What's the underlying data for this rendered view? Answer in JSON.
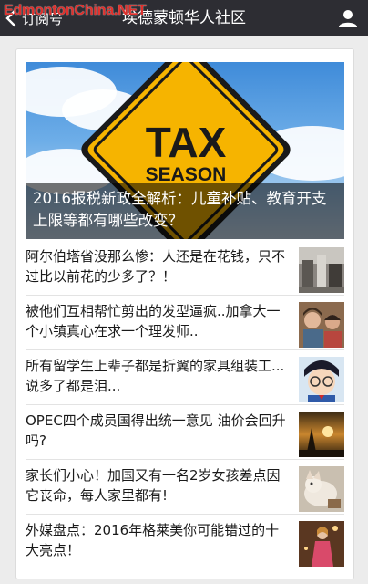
{
  "watermark": "EdmontonChina.NET",
  "nav": {
    "back_label": "订阅号",
    "title": "埃德蒙顿华人社区"
  },
  "hero": {
    "sign_line1": "TAX",
    "sign_line2": "SEASON",
    "caption": "2016报税新政全解析：儿童补贴、教育开支上限等都有哪些改变？"
  },
  "articles": [
    {
      "title": "阿尔伯塔省没那么惨：人还是在花钱，只不过比以前花的少多了？！",
      "thumb_icon": "city-street-photo-icon"
    },
    {
      "title": "被他们互相帮忙剪出的发型逼疯..加拿大一个小镇真心在求一个理发师..",
      "thumb_icon": "people-photo-icon"
    },
    {
      "title": "所有留学生上辈子都是折翼的家具组装工...说多了都是泪...",
      "thumb_icon": "cartoon-boy-photo-icon"
    },
    {
      "title": "OPEC四个成员国得出统一意见 油价会回升吗?",
      "thumb_icon": "sunset-oil-photo-icon"
    },
    {
      "title": "家长们小心！加国又有一名2岁女孩差点因它丧命，每人家里都有!",
      "thumb_icon": "pet-photo-icon"
    },
    {
      "title": "外媒盘点：2016年格莱美你可能错过的十大亮点！",
      "thumb_icon": "stage-performer-photo-icon"
    }
  ]
}
